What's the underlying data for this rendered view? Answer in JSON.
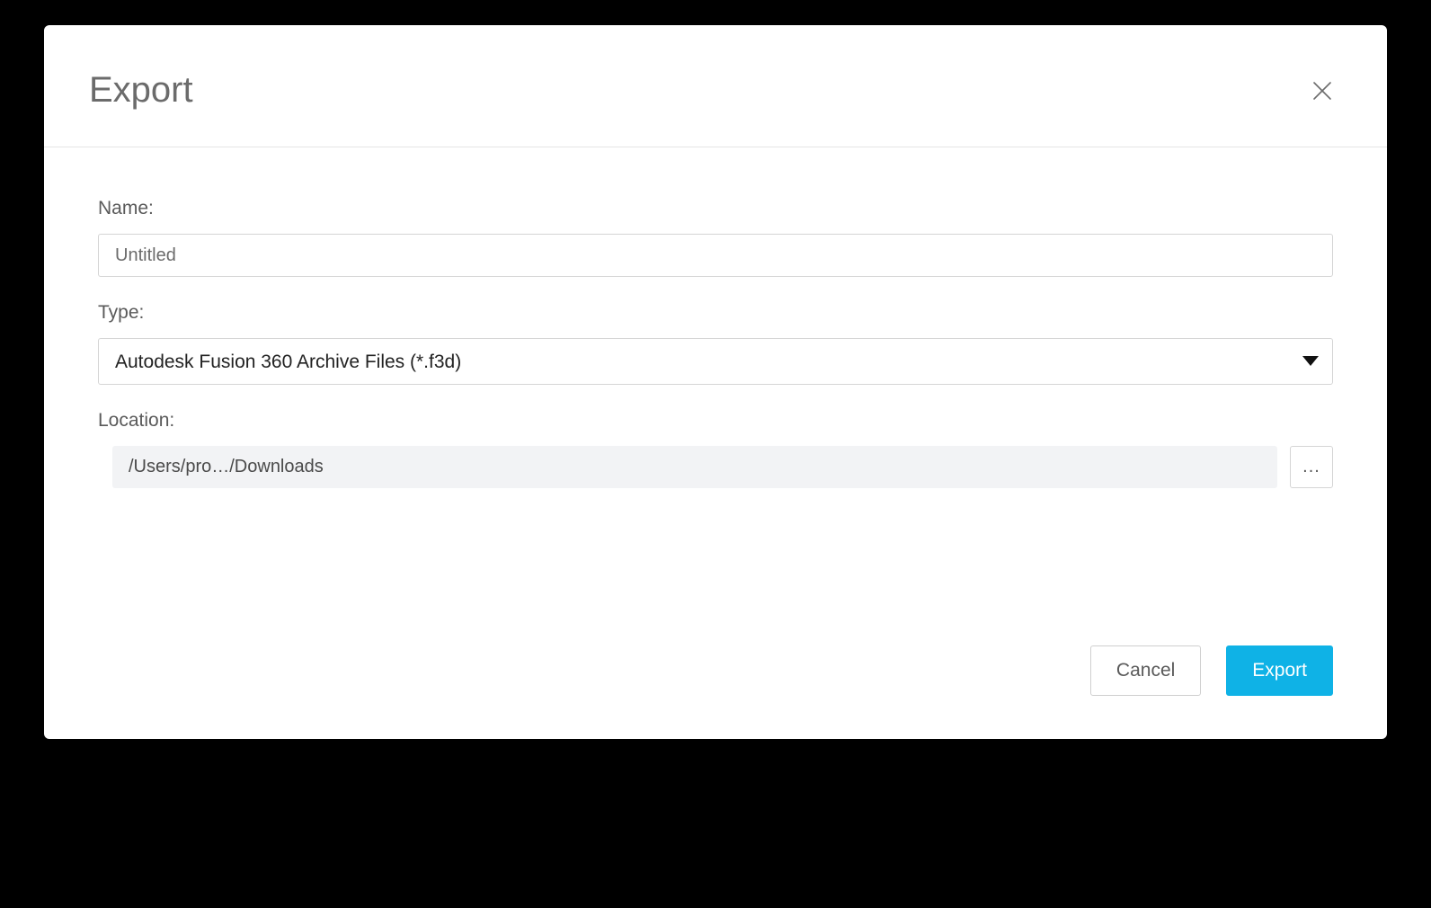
{
  "dialog": {
    "title": "Export",
    "fields": {
      "name": {
        "label": "Name:",
        "value": "Untitled"
      },
      "type": {
        "label": "Type:",
        "selected": "Autodesk Fusion 360 Archive Files (*.f3d)"
      },
      "location": {
        "label": "Location:",
        "path": "/Users/pro…/Downloads",
        "browse": "..."
      }
    },
    "buttons": {
      "cancel": "Cancel",
      "export": "Export"
    }
  }
}
